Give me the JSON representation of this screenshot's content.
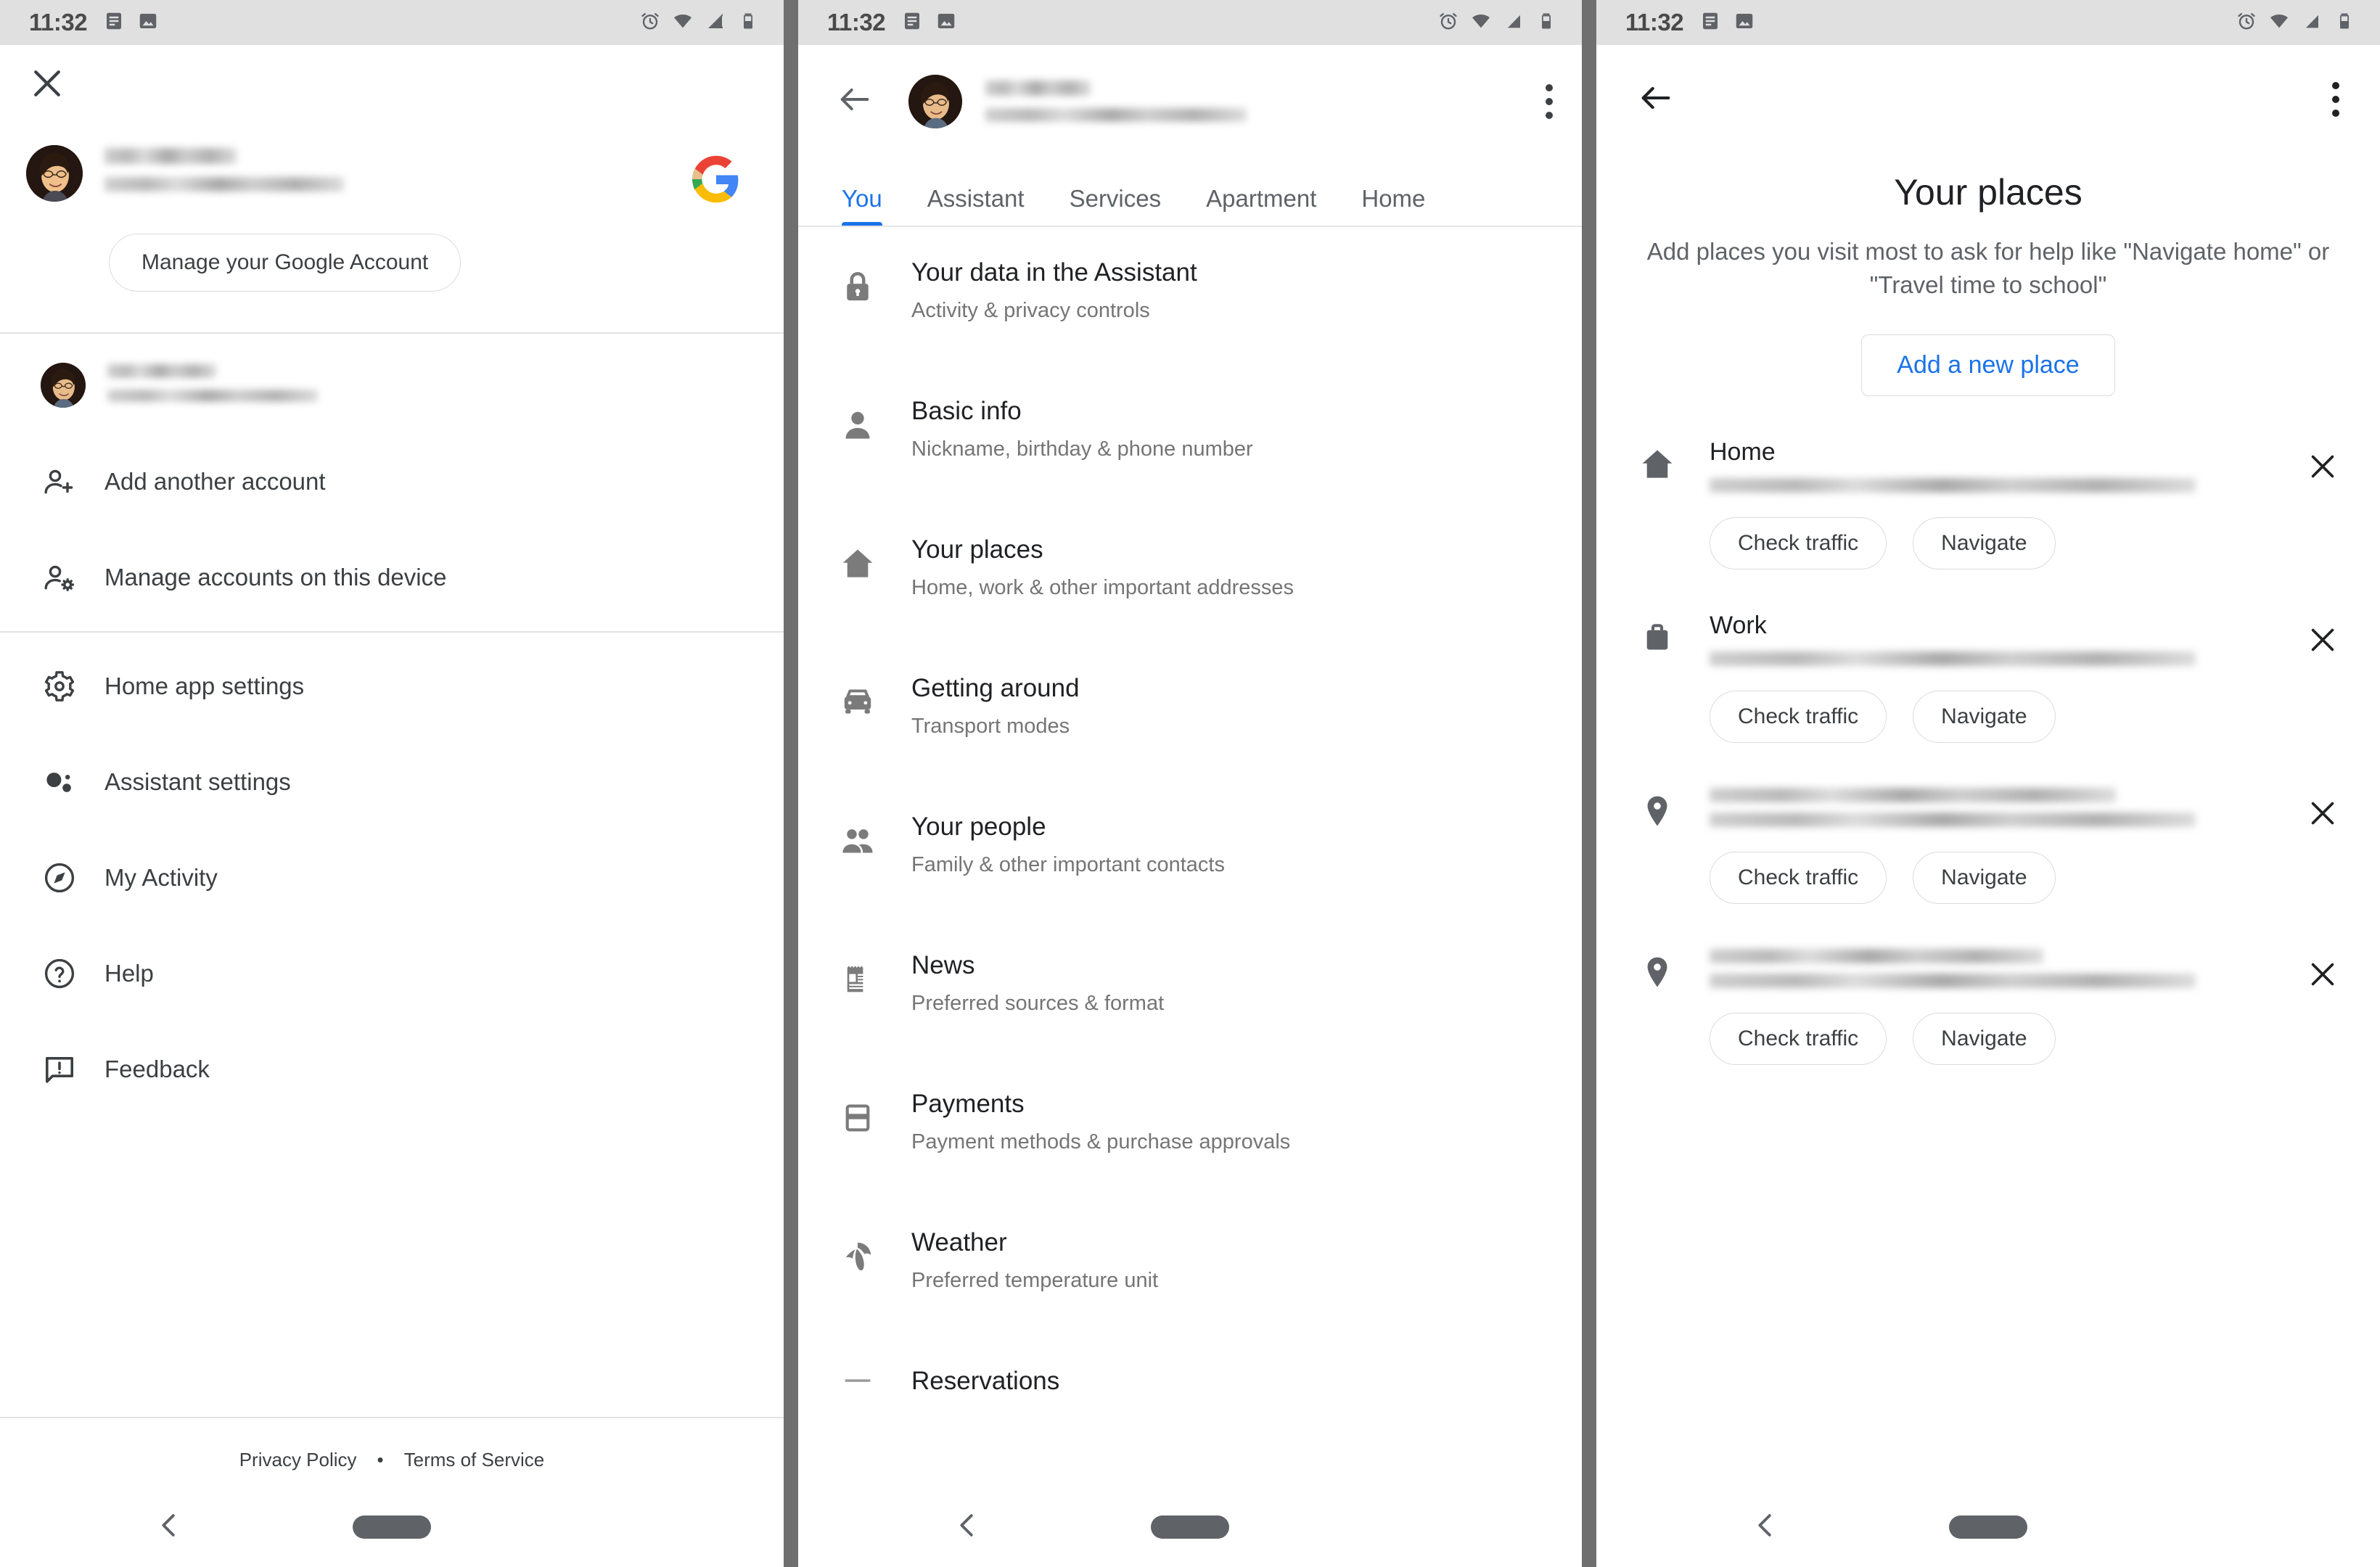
{
  "status_bar": {
    "time": "11:32",
    "left_icons": [
      "notes-icon",
      "image-icon"
    ],
    "right_icons": [
      "alarm-icon",
      "wifi-icon",
      "signal-icon",
      "battery-icon"
    ]
  },
  "left_panel": {
    "close_icon": "close-icon",
    "google_logo": "google-g-logo",
    "manage_account_button": "Manage your Google Account",
    "account_rows": [
      {
        "name_redacted": true,
        "email_redacted": true
      },
      {
        "name_redacted": true,
        "email_redacted": true
      }
    ],
    "menu_group_accounts": [
      {
        "icon": "person-add-icon",
        "label": "Add another account"
      },
      {
        "icon": "manage-accounts-icon",
        "label": "Manage accounts on this device"
      }
    ],
    "menu_group_settings": [
      {
        "icon": "gear-icon",
        "label": "Home app settings"
      },
      {
        "icon": "assistant-icon",
        "label": "Assistant settings"
      },
      {
        "icon": "compass-icon",
        "label": "My Activity"
      },
      {
        "icon": "help-circle-icon",
        "label": "Help"
      },
      {
        "icon": "feedback-icon",
        "label": "Feedback"
      }
    ],
    "footer": {
      "privacy_policy": "Privacy Policy",
      "separator": "•",
      "terms_of_service": "Terms of Service"
    }
  },
  "mid_panel": {
    "back_icon": "back-arrow-icon",
    "overflow_icon": "more-vertical-icon",
    "account": {
      "name_redacted": true,
      "email_redacted": true
    },
    "tabs": [
      {
        "label": "You",
        "active": true
      },
      {
        "label": "Assistant",
        "active": false
      },
      {
        "label": "Services",
        "active": false
      },
      {
        "label": "Apartment",
        "active": false
      },
      {
        "label": "Home",
        "active": false
      }
    ],
    "items": [
      {
        "icon": "lock-icon",
        "title": "Your data in the Assistant",
        "subtitle": "Activity & privacy controls"
      },
      {
        "icon": "person-icon",
        "title": "Basic info",
        "subtitle": "Nickname, birthday & phone number"
      },
      {
        "icon": "home-icon",
        "title": "Your places",
        "subtitle": "Home, work & other important addresses"
      },
      {
        "icon": "car-icon",
        "title": "Getting around",
        "subtitle": "Transport modes"
      },
      {
        "icon": "people-icon",
        "title": "Your people",
        "subtitle": "Family & other important contacts"
      },
      {
        "icon": "news-icon",
        "title": "News",
        "subtitle": "Preferred sources & format"
      },
      {
        "icon": "card-icon",
        "title": "Payments",
        "subtitle": "Payment methods & purchase approvals"
      },
      {
        "icon": "umbrella-icon",
        "title": "Weather",
        "subtitle": "Preferred temperature unit"
      },
      {
        "icon": "restaurant-icon",
        "title": "Reservations",
        "subtitle": ""
      }
    ]
  },
  "right_panel": {
    "back_icon": "back-arrow-icon",
    "overflow_icon": "more-vertical-icon",
    "title": "Your places",
    "subtitle": "Add places you visit most to ask for help like \"Navigate home\" or \"Travel time to school\"",
    "add_button": "Add a new place",
    "places": [
      {
        "icon": "home-icon",
        "name": "Home",
        "address_redacted": true,
        "address_lines": 1,
        "check_traffic": "Check traffic",
        "navigate": "Navigate",
        "remove_icon": "close-icon"
      },
      {
        "icon": "briefcase-icon",
        "name": "Work",
        "address_redacted": true,
        "address_lines": 1,
        "check_traffic": "Check traffic",
        "navigate": "Navigate",
        "remove_icon": "close-icon"
      },
      {
        "icon": "pin-icon",
        "name": "",
        "address_redacted": true,
        "address_lines": 2,
        "check_traffic": "Check traffic",
        "navigate": "Navigate",
        "remove_icon": "close-icon"
      },
      {
        "icon": "pin-icon",
        "name": "",
        "address_redacted": true,
        "address_lines": 2,
        "check_traffic": "Check traffic",
        "navigate": "Navigate",
        "remove_icon": "close-icon"
      }
    ]
  },
  "nav_bar": {
    "back_icon": "nav-back-icon",
    "home_pill": "nav-home-pill"
  },
  "colors": {
    "accent_blue": "#1a73e8",
    "status_bar_bg": "#e0e0e0",
    "text_primary": "#202124",
    "text_secondary": "#5f6368",
    "divider": "#e2e3e5"
  }
}
